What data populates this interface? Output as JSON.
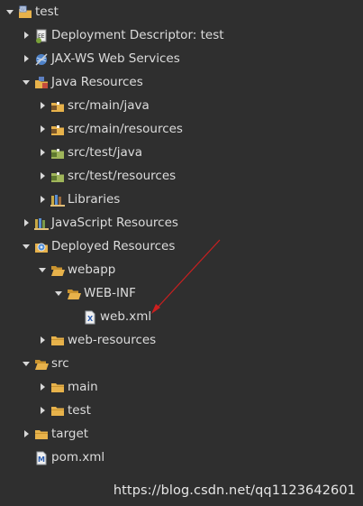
{
  "tree": [
    {
      "label": "test",
      "depth": 0,
      "expander": "down",
      "icon": "project-icon"
    },
    {
      "label": "Deployment Descriptor: test",
      "depth": 1,
      "expander": "right",
      "icon": "deployment-descriptor-icon"
    },
    {
      "label": "JAX-WS Web Services",
      "depth": 1,
      "expander": "right",
      "icon": "web-services-icon"
    },
    {
      "label": "Java Resources",
      "depth": 1,
      "expander": "down",
      "icon": "java-resources-icon"
    },
    {
      "label": "src/main/java",
      "depth": 2,
      "expander": "right",
      "icon": "source-folder-icon"
    },
    {
      "label": "src/main/resources",
      "depth": 2,
      "expander": "right",
      "icon": "source-folder-icon"
    },
    {
      "label": "src/test/java",
      "depth": 2,
      "expander": "right",
      "icon": "test-source-folder-icon"
    },
    {
      "label": "src/test/resources",
      "depth": 2,
      "expander": "right",
      "icon": "test-source-folder-icon"
    },
    {
      "label": "Libraries",
      "depth": 2,
      "expander": "right",
      "icon": "libraries-icon"
    },
    {
      "label": "JavaScript Resources",
      "depth": 1,
      "expander": "right",
      "icon": "javascript-resources-icon"
    },
    {
      "label": "Deployed Resources",
      "depth": 1,
      "expander": "down",
      "icon": "deployed-resources-icon"
    },
    {
      "label": "webapp",
      "depth": 2,
      "expander": "down",
      "icon": "folder-open-icon"
    },
    {
      "label": "WEB-INF",
      "depth": 3,
      "expander": "down",
      "icon": "folder-open-icon"
    },
    {
      "label": "web.xml",
      "depth": 4,
      "expander": "none",
      "icon": "xml-file-icon"
    },
    {
      "label": "web-resources",
      "depth": 2,
      "expander": "right",
      "icon": "folder-icon"
    },
    {
      "label": "src",
      "depth": 1,
      "expander": "down",
      "icon": "folder-open-icon"
    },
    {
      "label": "main",
      "depth": 2,
      "expander": "right",
      "icon": "folder-icon"
    },
    {
      "label": "test",
      "depth": 2,
      "expander": "right",
      "icon": "folder-icon"
    },
    {
      "label": "target",
      "depth": 1,
      "expander": "right",
      "icon": "folder-icon"
    },
    {
      "label": "pom.xml",
      "depth": 1,
      "expander": "none",
      "icon": "maven-pom-icon"
    }
  ],
  "watermark": "https://blog.csdn.net/qq1123642601",
  "colors": {
    "background": "#2f2f2f",
    "text": "#dcdcdc",
    "annotation_arrow": "#cc1f1f",
    "folder": "#e7b24b"
  }
}
